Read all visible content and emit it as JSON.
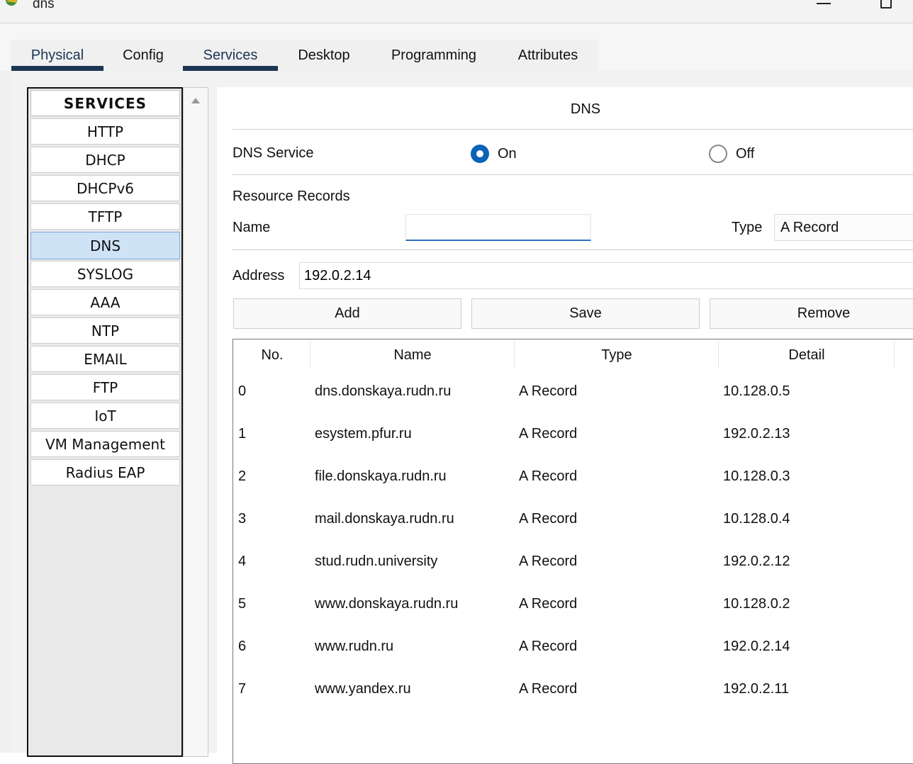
{
  "window": {
    "title": "dns"
  },
  "tabs": [
    {
      "label": "Physical"
    },
    {
      "label": "Config"
    },
    {
      "label": "Services"
    },
    {
      "label": "Desktop"
    },
    {
      "label": "Programming"
    },
    {
      "label": "Attributes"
    }
  ],
  "services": {
    "header": "SERVICES",
    "items": [
      "HTTP",
      "DHCP",
      "DHCPv6",
      "TFTP",
      "DNS",
      "SYSLOG",
      "AAA",
      "NTP",
      "EMAIL",
      "FTP",
      "IoT",
      "VM Management",
      "Radius EAP"
    ],
    "selected": "DNS"
  },
  "dns": {
    "heading": "DNS",
    "service_label": "DNS Service",
    "on_label": "On",
    "off_label": "Off",
    "service_state": "On",
    "resource_records_label": "Resource Records",
    "name_label": "Name",
    "name_value": "",
    "type_label": "Type",
    "type_value": "A Record",
    "address_label": "Address",
    "address_value": "192.0.2.14",
    "buttons": {
      "add": "Add",
      "save": "Save",
      "remove": "Remove"
    }
  },
  "table": {
    "headers": [
      "No.",
      "Name",
      "Type",
      "Detail"
    ],
    "rows": [
      {
        "no": "0",
        "name": "dns.donskaya.rudn.ru",
        "type": "A Record",
        "detail": "10.128.0.5"
      },
      {
        "no": "1",
        "name": "esystem.pfur.ru",
        "type": "A Record",
        "detail": "192.0.2.13"
      },
      {
        "no": "2",
        "name": "file.donskaya.rudn.ru",
        "type": "A Record",
        "detail": "10.128.0.3"
      },
      {
        "no": "3",
        "name": "mail.donskaya.rudn.ru",
        "type": "A Record",
        "detail": "10.128.0.4"
      },
      {
        "no": "4",
        "name": "stud.rudn.university",
        "type": "A Record",
        "detail": "192.0.2.12"
      },
      {
        "no": "5",
        "name": "www.donskaya.rudn.ru",
        "type": "A Record",
        "detail": "10.128.0.2"
      },
      {
        "no": "6",
        "name": "www.rudn.ru",
        "type": "A Record",
        "detail": "192.0.2.14"
      },
      {
        "no": "7",
        "name": "www.yandex.ru",
        "type": "A Record",
        "detail": "192.0.2.11"
      }
    ]
  },
  "colors": {
    "tab_underline": "#1b3553",
    "selected_service_bg": "#cfe3f7",
    "radio_on": "#0a63b5",
    "input_focus": "#2f6fc0"
  }
}
